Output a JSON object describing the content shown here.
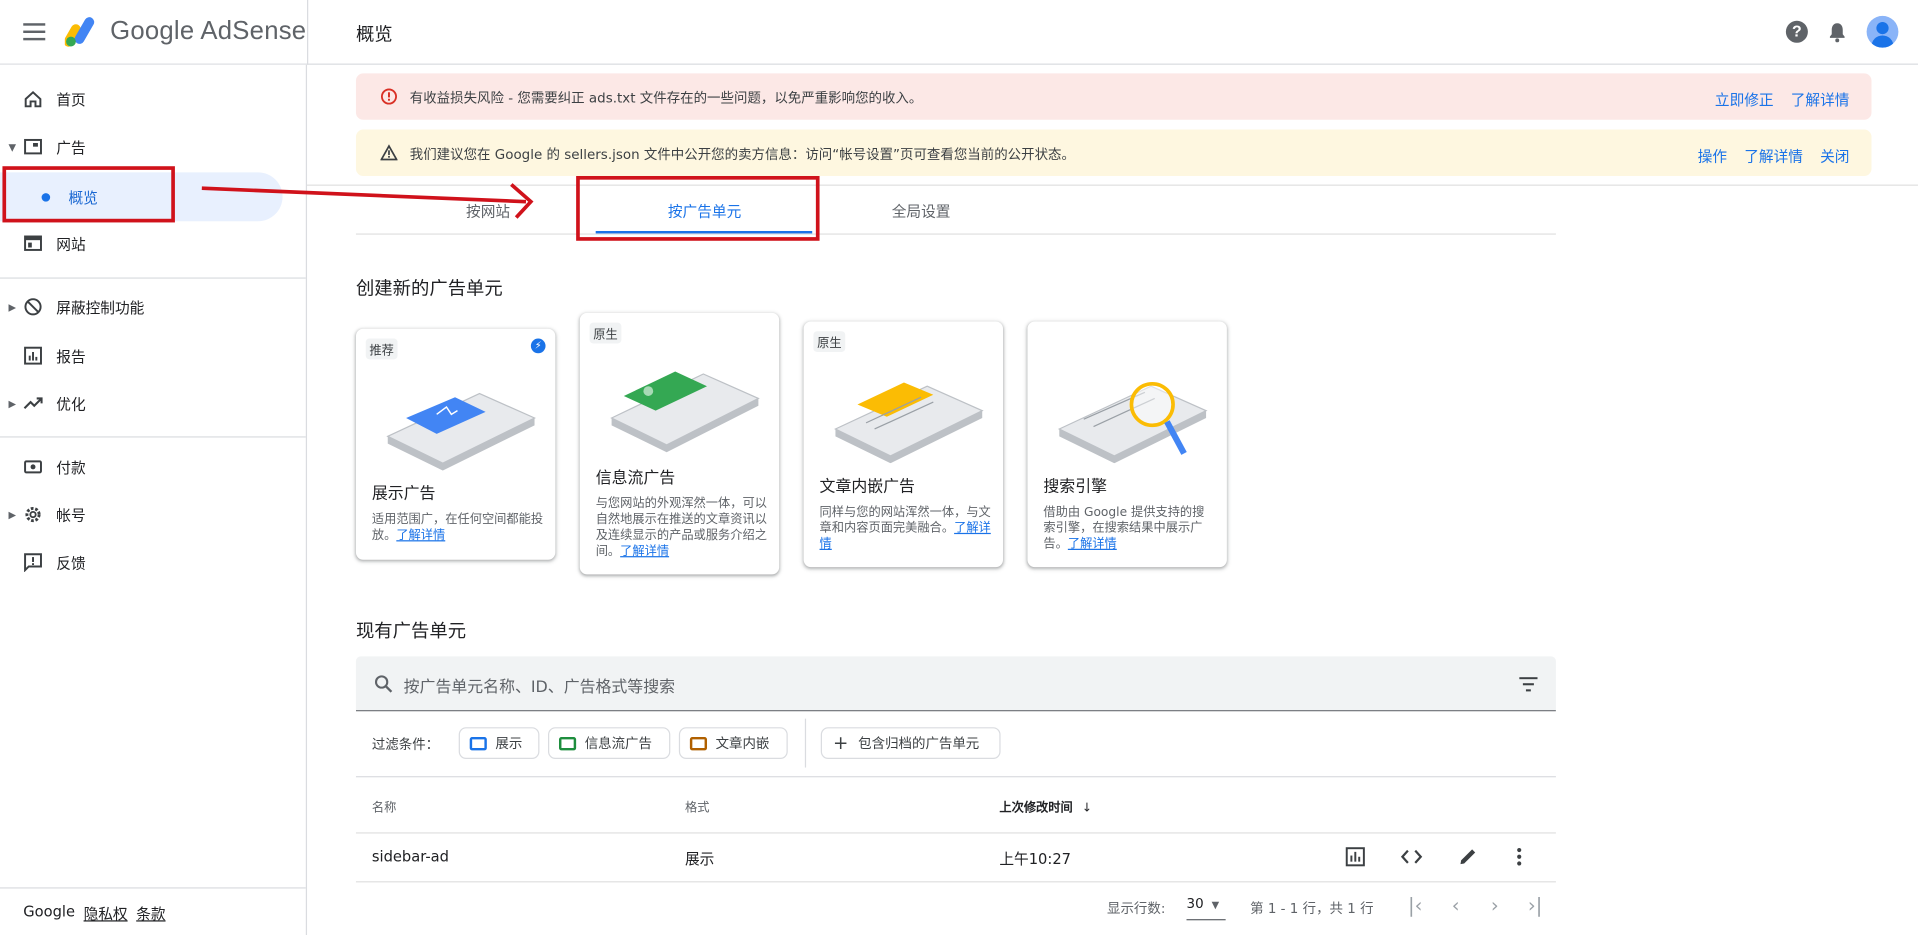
{
  "header": {
    "brand_google": "Google",
    "brand_product": "AdSense",
    "page_title": "概览"
  },
  "sidebar": {
    "items": [
      {
        "label": "首页",
        "icon": "home-icon"
      },
      {
        "label": "广告",
        "icon": "ads-icon",
        "expanded": true
      },
      {
        "label": "概览",
        "selected": true
      },
      {
        "label": "网站",
        "icon": "sites-icon"
      },
      {
        "label": "屏蔽控制功能",
        "icon": "block-icon"
      },
      {
        "label": "报告",
        "icon": "reports-icon"
      },
      {
        "label": "优化",
        "icon": "optimize-icon"
      },
      {
        "label": "付款",
        "icon": "payments-icon"
      },
      {
        "label": "帐号",
        "icon": "account-gear-icon"
      },
      {
        "label": "反馈",
        "icon": "feedback-icon"
      }
    ],
    "footer": {
      "google": "Google",
      "privacy": "隐私权",
      "terms": "条款"
    }
  },
  "banners": {
    "error": {
      "text": "有收益损失风险 - 您需要纠正 ads.txt 文件存在的一些问题，以免严重影响您的收入。",
      "fix": "立即修正",
      "learn_more": "了解详情"
    },
    "warning": {
      "text": "我们建议您在 Google 的 sellers.json 文件中公开您的卖方信息：访问“帐号设置”页可查看您当前的公开状态。",
      "action": "操作",
      "learn_more": "了解详情",
      "close": "关闭"
    }
  },
  "tabs": [
    {
      "label": "按网站"
    },
    {
      "label": "按广告单元",
      "active": true
    },
    {
      "label": "全局设置"
    }
  ],
  "create_section": {
    "title": "创建新的广告单元",
    "cards": [
      {
        "tag": "推荐",
        "title": "展示广告",
        "desc": "适用范围广，在任何空间都能投放。",
        "link": "了解详情"
      },
      {
        "tag": "原生",
        "title": "信息流广告",
        "desc": "与您网站的外观浑然一体，可以自然地展示在推送的文章资讯以及连续显示的产品或服务介绍之间。",
        "link": "了解详情"
      },
      {
        "tag": "原生",
        "title": "文章内嵌广告",
        "desc": "同样与您的网站浑然一体，与文章和内容页面完美融合。",
        "link": "了解详情"
      },
      {
        "tag": "",
        "title": "搜索引擎",
        "desc": "借助由 Google 提供支持的搜索引擎，在搜索结果中展示广告。",
        "link": "了解详情"
      }
    ]
  },
  "existing_section": {
    "title": "现有广告单元",
    "search_placeholder": "按广告单元名称、ID、广告格式等搜索",
    "filter_label": "过滤条件：",
    "chips": [
      {
        "label": "展示",
        "color": "#1a73e8"
      },
      {
        "label": "信息流广告",
        "color": "#1e8e3e"
      },
      {
        "label": "文章内嵌",
        "color": "#b06000"
      },
      {
        "label": "包含归档的广告单元"
      }
    ],
    "columns": [
      "名称",
      "格式",
      "上次修改时间"
    ],
    "rows": [
      {
        "name": "sidebar-ad",
        "format": "展示",
        "modified": "上午10:27"
      }
    ],
    "pagination": {
      "rows_label": "显示行数:",
      "rows_value": "30",
      "range": "第 1 - 1 行，共 1 行"
    }
  },
  "colors": {
    "accent": "#1a73e8",
    "annotation_red": "#d0121b",
    "error_bg": "#fce8e6",
    "warn_bg": "#fef7e0"
  }
}
